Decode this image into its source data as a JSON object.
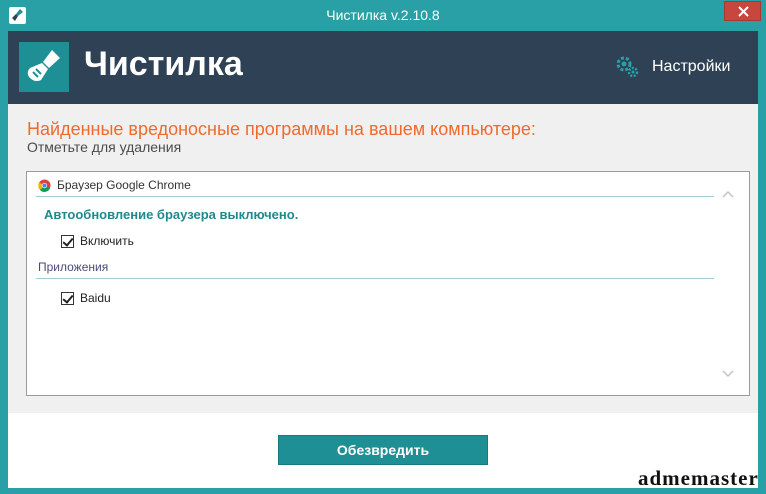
{
  "window": {
    "title": "Чистилка v.2.10.8"
  },
  "header": {
    "app_name": "Чистилка",
    "settings_label": "Настройки",
    "logo_icon": "broom-icon",
    "settings_icon": "gear-icon"
  },
  "main": {
    "heading": "Найденные вредоносные программы на вашем компьютере:",
    "subheading": "Отметьте для удаления"
  },
  "list": {
    "browser": {
      "label": "Браузер Google Chrome",
      "icon": "chrome-icon"
    },
    "warning": "Автообновление браузера выключено.",
    "enable_item": {
      "label": "Включить",
      "checked": true
    },
    "section_label": "Приложения",
    "apps": [
      {
        "label": "Baidu",
        "checked": true
      }
    ]
  },
  "footer": {
    "action_label": "Обезвредить"
  },
  "watermark": "admemaster",
  "colors": {
    "accent": "#29a0a6",
    "header_bg": "#2f4154",
    "heading_orange": "#ef6a2c",
    "close_red": "#c7463e"
  }
}
